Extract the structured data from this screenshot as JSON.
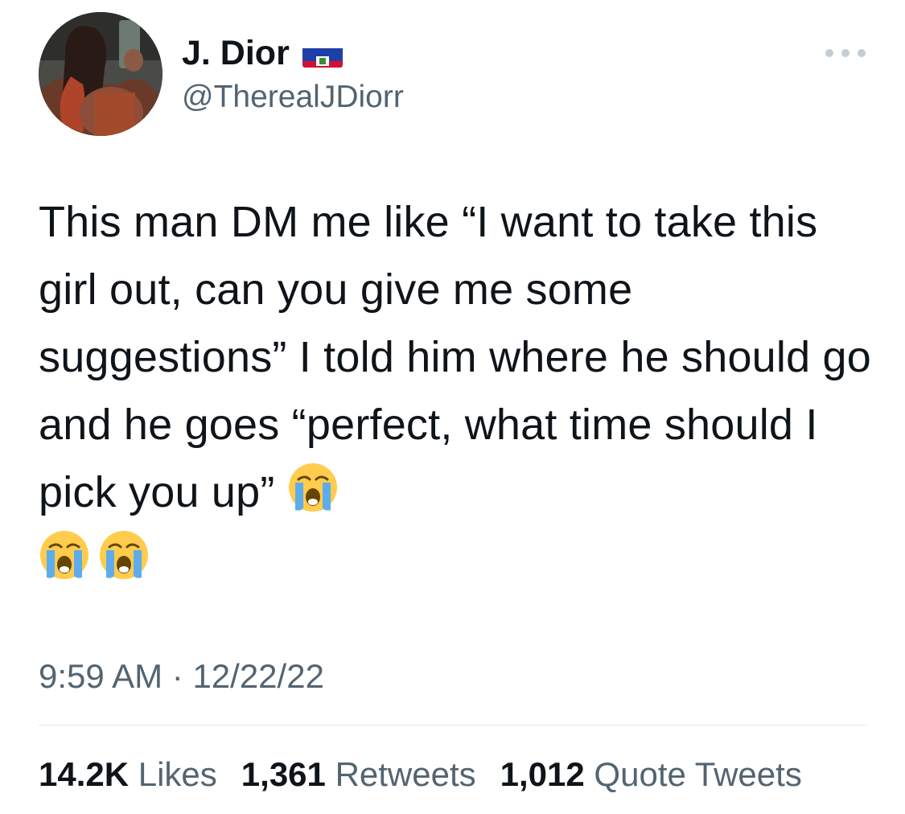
{
  "author": {
    "display_name": "J. Dior",
    "handle": "@TherealJDiorr",
    "flag_icon": "haiti-flag-icon",
    "avatar_icon": "profile-photo"
  },
  "more_icon": "more-options-icon",
  "tweet": {
    "text_parts": [
      "This man DM me like “I want to take this girl out, can you give me some suggestions” I told him where he should go and he goes “perfect, what time should I pick you up” "
    ],
    "emojis": [
      "loudly-crying-face-emoji",
      "loudly-crying-face-emoji",
      "loudly-crying-face-emoji"
    ]
  },
  "timestamp": {
    "time": "9:59 AM",
    "separator": " · ",
    "date": "12/22/22"
  },
  "stats": {
    "likes": {
      "count": "14.2K",
      "label": " Likes"
    },
    "retweets": {
      "count": "1,361",
      "label": " Retweets"
    },
    "quotes": {
      "count": "1,012",
      "label": " Quote Tweets"
    }
  },
  "colors": {
    "text": "#0f1419",
    "secondary": "#536471",
    "divider": "#e3e8ec",
    "flag_blue": "#1f3fa8",
    "flag_red": "#d21034"
  }
}
